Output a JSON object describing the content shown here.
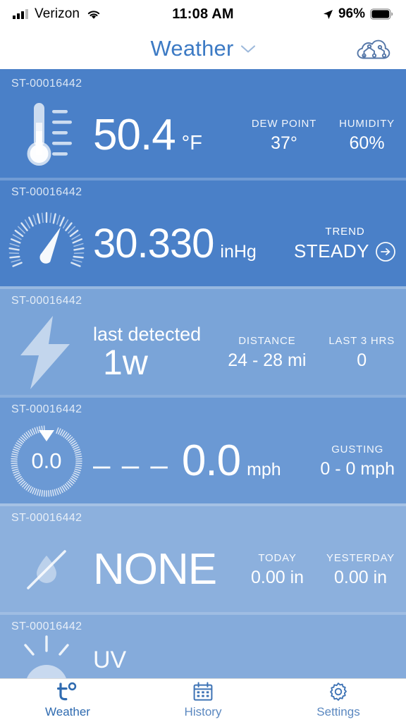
{
  "status_bar": {
    "carrier": "Verizon",
    "wifi_icon": "wifi-icon",
    "signal_icon": "cellular-signal-icon",
    "time": "11:08 AM",
    "location_icon": "location-arrow-icon",
    "battery_percent": "96%",
    "battery_icon": "battery-full-icon"
  },
  "header": {
    "title": "Weather",
    "dropdown_icon": "chevron-down-icon",
    "cloud_icon": "cloud-network-icon",
    "title_color": "#3c7ac4"
  },
  "cards": [
    {
      "sensor_id": "ST-00016442",
      "icon": "thermometer-icon",
      "value": "50.4",
      "unit": "°F",
      "bg": "#4a80c8",
      "stats": [
        {
          "label": "DEW POINT",
          "value": "37°"
        },
        {
          "label": "HUMIDITY",
          "value": "60%"
        }
      ]
    },
    {
      "sensor_id": "ST-00016442",
      "icon": "barometer-icon",
      "value": "30.330",
      "unit": "inHg",
      "bg": "#4a80c8",
      "trend": {
        "label": "TREND",
        "value": "STEADY",
        "icon": "arrow-right-circle-icon"
      }
    },
    {
      "sensor_id": "ST-00016442",
      "icon": "lightning-bolt-icon",
      "caption": "last detected",
      "value": "1w",
      "bg": "#7aa4d8",
      "stats": [
        {
          "label": "DISTANCE",
          "value": "24 - 28 mi"
        },
        {
          "label": "LAST 3 HRS",
          "value": "0"
        }
      ]
    },
    {
      "sensor_id": "ST-00016442",
      "icon": "wind-dial-icon",
      "dial_value": "0.0",
      "direction": "– – –",
      "value": "0.0",
      "unit": "mph",
      "bg": "#6b99d4",
      "stats": [
        {
          "label": "GUSTING",
          "value": "0 - 0 mph"
        }
      ]
    },
    {
      "sensor_id": "ST-00016442",
      "icon": "no-rain-icon",
      "value": "NONE",
      "bg": "#8cb0dd",
      "stats": [
        {
          "label": "TODAY",
          "value": "0.00 in"
        },
        {
          "label": "YESTERDAY",
          "value": "0.00 in"
        }
      ]
    },
    {
      "sensor_id": "ST-00016442",
      "icon": "sun-icon",
      "value": "UV",
      "bg": "#85abdb"
    }
  ],
  "tabbar": {
    "items": [
      {
        "label": "Weather",
        "icon": "temperature-t-degree-icon",
        "active": true
      },
      {
        "label": "History",
        "icon": "calendar-icon",
        "active": false
      },
      {
        "label": "Settings",
        "icon": "gear-icon",
        "active": false
      }
    ],
    "active_color": "#2f6bb0",
    "inactive_color": "#5b88c0"
  }
}
